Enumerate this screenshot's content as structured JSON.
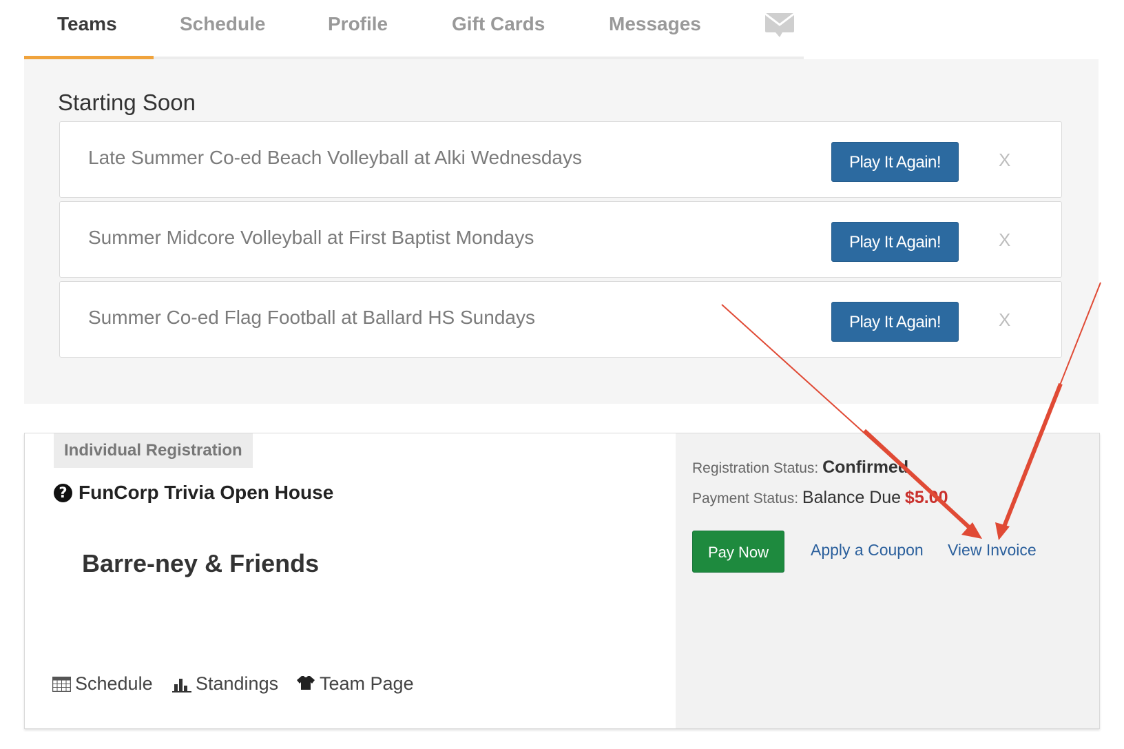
{
  "tabs": [
    {
      "label": "Teams",
      "active": true
    },
    {
      "label": "Schedule",
      "active": false
    },
    {
      "label": "Profile",
      "active": false
    },
    {
      "label": "Gift Cards",
      "active": false
    },
    {
      "label": "Messages",
      "active": false,
      "icon": "envelope-icon"
    }
  ],
  "starting_soon": {
    "title": "Starting Soon",
    "items": [
      {
        "name": "Late Summer Co-ed Beach Volleyball at Alki Wednesdays",
        "button_label": "Play It Again!",
        "dismiss_label": "X"
      },
      {
        "name": "Summer Midcore Volleyball at First Baptist Mondays",
        "button_label": "Play It Again!",
        "dismiss_label": "X"
      },
      {
        "name": "Summer Co-ed Flag Football at Ballard HS Sundays",
        "button_label": "Play It Again!",
        "dismiss_label": "X"
      }
    ]
  },
  "registration": {
    "badge": "Individual Registration",
    "event_icon": "question-circle-icon",
    "event_name": "FunCorp Trivia Open House",
    "team_name": "Barre-ney & Friends",
    "links": {
      "schedule": "Schedule",
      "standings": "Standings",
      "team_page": "Team Page"
    },
    "status": {
      "registration_label": "Registration Status:",
      "registration_value": "Confirmed",
      "payment_label": "Payment Status:",
      "payment_value": "Balance Due",
      "balance": "$5.00"
    },
    "actions": {
      "pay_now": "Pay Now",
      "apply_coupon": "Apply a Coupon",
      "view_invoice": "View Invoice"
    }
  },
  "colors": {
    "tab_accent": "#f0a33c",
    "play_button": "#2c6aa0",
    "pay_button": "#1e8a3e",
    "balance": "#c9302c",
    "link": "#2a5f9c",
    "annotation_arrow": "#e04a35"
  }
}
